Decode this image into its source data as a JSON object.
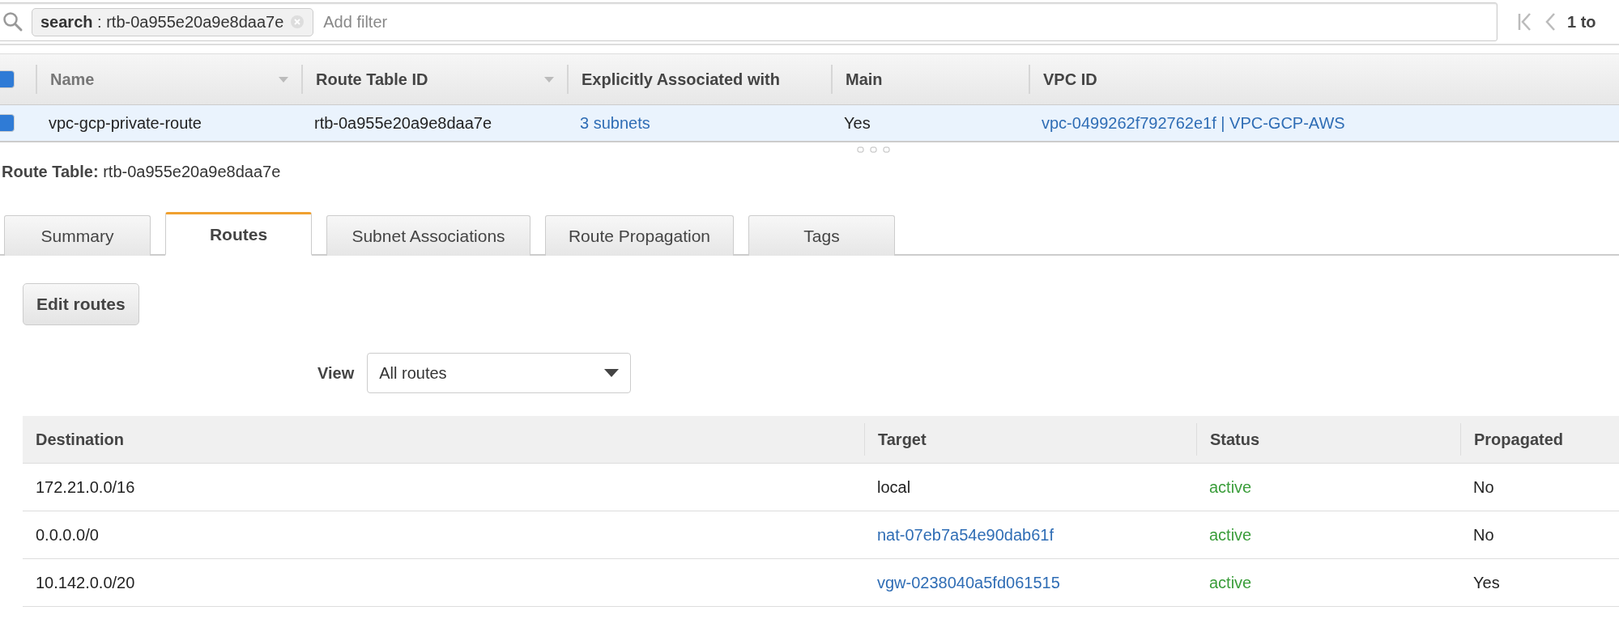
{
  "filter": {
    "token": "**search** : rtb-0a955e20a9e8daa7e",
    "placeholder": "Add filter"
  },
  "pagination": {
    "text": "1 to"
  },
  "table": {
    "all_checked": true,
    "columns": [
      {
        "label": "Name",
        "sortable": true
      },
      {
        "label": "Route Table ID",
        "sortable": true
      },
      {
        "label": "Explicitly Associated with",
        "sortable": false
      },
      {
        "label": "Main",
        "sortable": false
      },
      {
        "label": "VPC ID",
        "sortable": false
      }
    ],
    "rows": [
      {
        "selected": true,
        "checked": true,
        "cells": [
          {
            "kind": "text",
            "text": "vpc-gcp-private-route"
          },
          {
            "kind": "text",
            "text": "rtb-0a955e20a9e8daa7e"
          },
          {
            "kind": "link",
            "text": "3 subnets"
          },
          {
            "kind": "text",
            "text": "Yes"
          },
          {
            "kind": "link",
            "text": "vpc-0499262f792762e1f | VPC-GCP-AWS"
          }
        ]
      }
    ]
  },
  "detail": {
    "label": "Route Table:",
    "value": "rtb-0a955e20a9e8daa7e"
  },
  "tabs": [
    {
      "label": "Summary",
      "selected": false
    },
    {
      "label": "Routes",
      "selected": true
    },
    {
      "label": "Subnet Associations",
      "selected": false
    },
    {
      "label": "Route Propagation",
      "selected": false
    },
    {
      "label": "Tags",
      "selected": false
    }
  ],
  "edit_button": "Edit routes",
  "view": {
    "label": "View",
    "value": "All routes"
  },
  "routes": {
    "columns": [
      "Destination",
      "Target",
      "Status",
      "Propagated"
    ],
    "rows": [
      [
        {
          "kind": "text",
          "text": "172.21.0.0/16"
        },
        {
          "kind": "text",
          "text": "local"
        },
        {
          "kind": "status",
          "text": "active"
        },
        {
          "kind": "text",
          "text": "No"
        }
      ],
      [
        {
          "kind": "text",
          "text": "0.0.0.0/0"
        },
        {
          "kind": "link",
          "text": "nat-07eb7a54e90dab61f"
        },
        {
          "kind": "status",
          "text": "active"
        },
        {
          "kind": "text",
          "text": "No"
        }
      ],
      [
        {
          "kind": "text",
          "text": "10.142.0.0/20"
        },
        {
          "kind": "link",
          "text": "vgw-0238040a5fd061515"
        },
        {
          "kind": "status",
          "text": "active"
        },
        {
          "kind": "text",
          "text": "Yes"
        }
      ]
    ]
  }
}
